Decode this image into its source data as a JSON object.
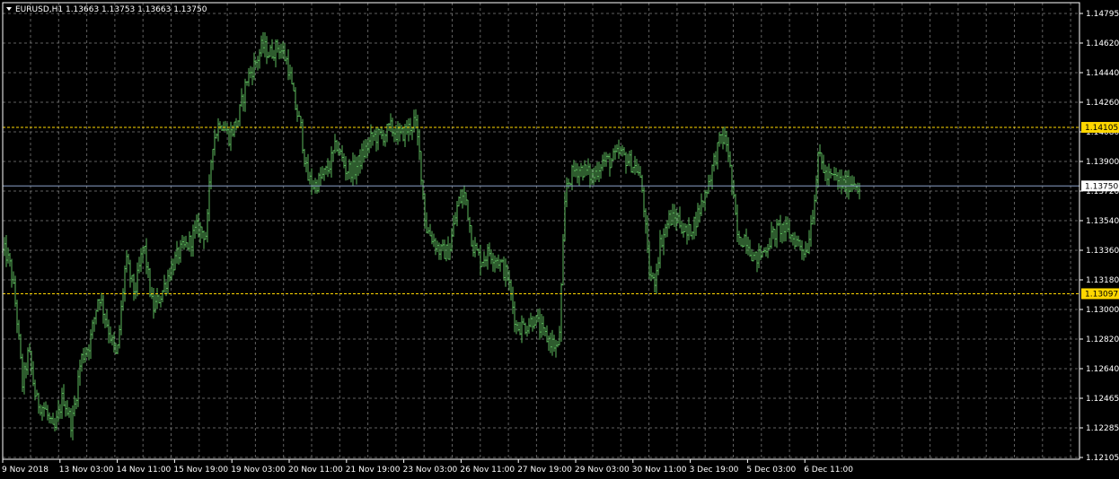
{
  "chart_data": {
    "type": "bar",
    "symbol_header": "EURUSD,H1  1.13663 1.13753 1.13663 1.13750",
    "ylim": [
      1.12105,
      1.14795
    ],
    "y_ticks": [
      "1.14795",
      "1.14620",
      "1.14440",
      "1.14260",
      "1.14080",
      "1.13900",
      "1.13720",
      "1.13540",
      "1.13360",
      "1.13180",
      "1.13000",
      "1.12820",
      "1.12640",
      "1.12465",
      "1.12285",
      "1.12105"
    ],
    "x_ticks": [
      "9 Nov 2018",
      "13 Nov 03:00",
      "14 Nov 11:00",
      "15 Nov 19:00",
      "19 Nov 03:00",
      "20 Nov 11:00",
      "21 Nov 19:00",
      "23 Nov 03:00",
      "26 Nov 11:00",
      "27 Nov 19:00",
      "29 Nov 03:00",
      "30 Nov 11:00",
      "3 Dec 19:00",
      "5 Dec 03:00",
      "6 Dec 11:00"
    ],
    "grid": true,
    "bar_color": "#5cb85c",
    "grid_color": "#b0b0b0",
    "current_price": {
      "value": 1.1375,
      "label": "1.13750",
      "line_color": "#8aa0c8",
      "tag_bg": "#ffffff",
      "tag_fg": "#000000"
    },
    "levels": [
      {
        "value": 1.14105,
        "label": "1.14105",
        "color": "#ffd700"
      },
      {
        "value": 1.13097,
        "label": "1.13097",
        "color": "#ffd700"
      }
    ],
    "anchors_close": [
      [
        0,
        1.1335
      ],
      [
        6,
        1.1335
      ],
      [
        12,
        1.1325
      ],
      [
        18,
        1.13
      ],
      [
        25,
        1.1255
      ],
      [
        32,
        1.1275
      ],
      [
        40,
        1.1245
      ],
      [
        50,
        1.124
      ],
      [
        60,
        1.1225
      ],
      [
        70,
        1.1248
      ],
      [
        80,
        1.123
      ],
      [
        90,
        1.127
      ],
      [
        100,
        1.128
      ],
      [
        110,
        1.131
      ],
      [
        120,
        1.129
      ],
      [
        130,
        1.127
      ],
      [
        140,
        1.133
      ],
      [
        150,
        1.131
      ],
      [
        160,
        1.134
      ],
      [
        170,
        1.13
      ],
      [
        180,
        1.131
      ],
      [
        190,
        1.1325
      ],
      [
        200,
        1.1335
      ],
      [
        210,
        1.134
      ],
      [
        220,
        1.135
      ],
      [
        230,
        1.1345
      ],
      [
        236,
        1.14
      ],
      [
        245,
        1.1415
      ],
      [
        255,
        1.1405
      ],
      [
        265,
        1.1415
      ],
      [
        275,
        1.144
      ],
      [
        285,
        1.145
      ],
      [
        292,
        1.146
      ],
      [
        300,
        1.1455
      ],
      [
        310,
        1.146
      ],
      [
        320,
        1.145
      ],
      [
        328,
        1.1425
      ],
      [
        335,
        1.141
      ],
      [
        342,
        1.138
      ],
      [
        350,
        1.1375
      ],
      [
        358,
        1.138
      ],
      [
        365,
        1.1385
      ],
      [
        375,
        1.14
      ],
      [
        385,
        1.1385
      ],
      [
        395,
        1.1385
      ],
      [
        405,
        1.1395
      ],
      [
        415,
        1.1405
      ],
      [
        425,
        1.1405
      ],
      [
        435,
        1.141
      ],
      [
        445,
        1.1405
      ],
      [
        455,
        1.141
      ],
      [
        462,
        1.1415
      ],
      [
        468,
        1.139
      ],
      [
        474,
        1.135
      ],
      [
        480,
        1.1345
      ],
      [
        490,
        1.1335
      ],
      [
        500,
        1.1335
      ],
      [
        510,
        1.1365
      ],
      [
        518,
        1.137
      ],
      [
        526,
        1.134
      ],
      [
        535,
        1.133
      ],
      [
        545,
        1.1335
      ],
      [
        555,
        1.133
      ],
      [
        565,
        1.132
      ],
      [
        575,
        1.129
      ],
      [
        585,
        1.129
      ],
      [
        595,
        1.1295
      ],
      [
        605,
        1.1285
      ],
      [
        615,
        1.128
      ],
      [
        622,
        1.1275
      ],
      [
        630,
        1.1375
      ],
      [
        640,
        1.1385
      ],
      [
        650,
        1.1385
      ],
      [
        660,
        1.138
      ],
      [
        670,
        1.139
      ],
      [
        680,
        1.139
      ],
      [
        690,
        1.1395
      ],
      [
        700,
        1.139
      ],
      [
        710,
        1.1385
      ],
      [
        716,
        1.137
      ],
      [
        722,
        1.1325
      ],
      [
        728,
        1.1315
      ],
      [
        735,
        1.134
      ],
      [
        745,
        1.1355
      ],
      [
        755,
        1.1355
      ],
      [
        765,
        1.1345
      ],
      [
        775,
        1.1355
      ],
      [
        785,
        1.137
      ],
      [
        795,
        1.139
      ],
      [
        803,
        1.1405
      ],
      [
        810,
        1.14
      ],
      [
        816,
        1.137
      ],
      [
        822,
        1.134
      ],
      [
        830,
        1.1345
      ],
      [
        840,
        1.133
      ],
      [
        850,
        1.1335
      ],
      [
        860,
        1.1345
      ],
      [
        870,
        1.135
      ],
      [
        880,
        1.1345
      ],
      [
        890,
        1.134
      ],
      [
        898,
        1.1335
      ],
      [
        905,
        1.136
      ],
      [
        912,
        1.1395
      ],
      [
        920,
        1.138
      ],
      [
        930,
        1.138
      ],
      [
        940,
        1.1375
      ],
      [
        950,
        1.1378
      ],
      [
        957,
        1.1375
      ]
    ]
  }
}
